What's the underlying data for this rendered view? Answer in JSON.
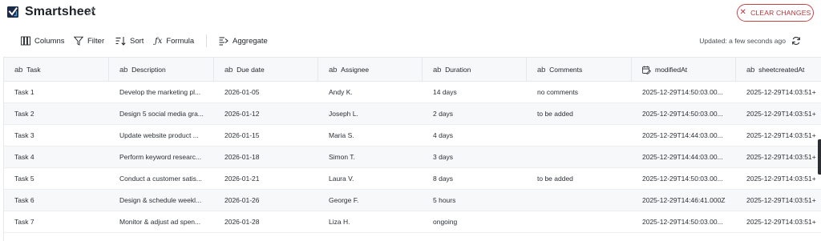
{
  "app": {
    "title": "Smartsheet",
    "icons": {
      "logo": "smartsheet-logo",
      "edit": "pencil-icon"
    },
    "clear_changes": {
      "label": "CLEAR CHANGES",
      "icon": "close-icon",
      "color": "#c8444a"
    }
  },
  "toolbar": {
    "items": [
      {
        "label": "Columns",
        "icon": "columns-icon"
      },
      {
        "label": "Filter",
        "icon": "filter-icon"
      },
      {
        "label": "Sort",
        "icon": "sort-icon"
      },
      {
        "label": "Formula",
        "icon": "formula-icon"
      },
      {
        "label": "Aggregate",
        "icon": "aggregate-icon"
      }
    ],
    "updated_text": "Updated: a few seconds ago",
    "refresh_icon": "refresh-icon"
  },
  "table": {
    "columns": [
      {
        "type_icon": "ab",
        "label": "Task"
      },
      {
        "type_icon": "ab",
        "label": "Description"
      },
      {
        "type_icon": "ab",
        "label": "Due date"
      },
      {
        "type_icon": "ab",
        "label": "Assignee"
      },
      {
        "type_icon": "ab",
        "label": "Duration"
      },
      {
        "type_icon": "ab",
        "label": "Comments"
      },
      {
        "type_icon": "calendar-edit-icon",
        "label": "modifiedAt"
      },
      {
        "type_icon": "ab",
        "label": "sheetcreatedAt"
      }
    ],
    "rows": [
      [
        "Task 1",
        "Develop the marketing pl...",
        "2026-01-05",
        "Andy K.",
        "14 days",
        "no comments",
        "2025-12-29T14:50:03.00...",
        "2025-12-29T14:03:51+"
      ],
      [
        "Task 2",
        "Design 5 social media gra...",
        "2026-01-12",
        "Joseph L.",
        "2 days",
        "to be added",
        "2025-12-29T14:50:03.00...",
        "2025-12-29T14:03:51+"
      ],
      [
        "Task 3",
        "Update website product ...",
        "2026-01-15",
        "Maria S.",
        "4 days",
        "",
        "2025-12-29T14:44:03.00...",
        "2025-12-29T14:03:51+"
      ],
      [
        "Task 4",
        "Perform keyword researc...",
        "2026-01-18",
        "Simon T.",
        "3 days",
        "",
        "2025-12-29T14:44:03.00...",
        "2025-12-29T14:03:51+"
      ],
      [
        "Task 5",
        "Conduct a customer satis...",
        "2026-01-21",
        "Laura V.",
        "8 days",
        "to be added",
        "2025-12-29T14:50:03.00...",
        "2025-12-29T14:03:51+"
      ],
      [
        "Task 6",
        "Design & schedule weekl...",
        "2026-01-26",
        "George F.",
        "5 hours",
        "",
        "2025-12-29T14:46:41.000Z",
        "2025-12-29T14:03:51+"
      ],
      [
        "Task 7",
        "Monitor & adjust ad spen...",
        "2026-01-28",
        "Liza H.",
        "ongoing",
        "",
        "2025-12-29T14:50:03.00...",
        "2025-12-29T14:03:51+"
      ]
    ]
  }
}
